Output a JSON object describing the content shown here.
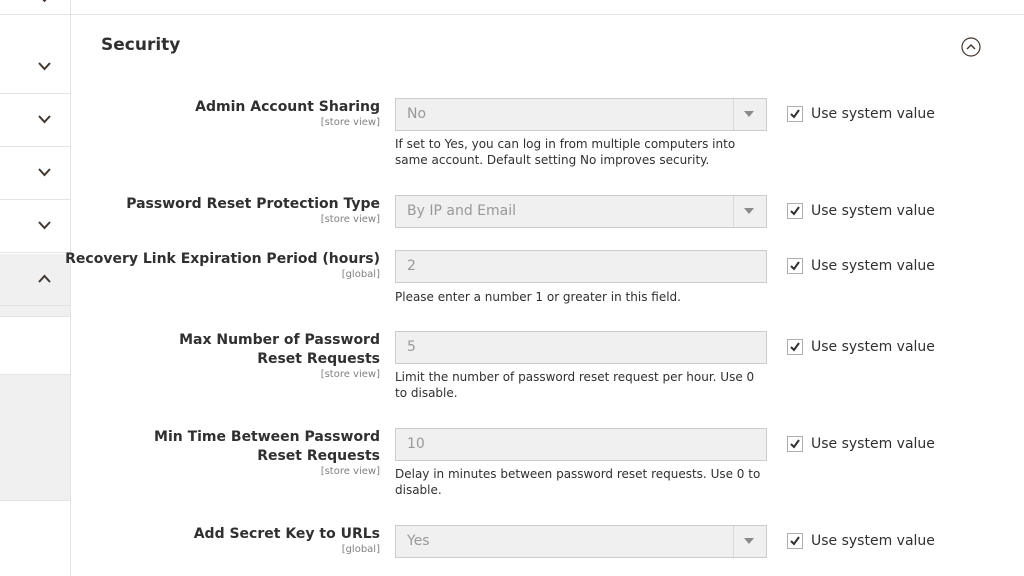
{
  "section": {
    "title": "Security"
  },
  "rows": [
    {
      "label": "Admin Account Sharing",
      "scope": "[store view]",
      "value": "No",
      "note": "If set to Yes, you can log in from multiple computers into same account. Default setting No improves security.",
      "use_system": "Use system value",
      "use_system_checked": true
    },
    {
      "label": "Password Reset Protection Type",
      "scope": "[store view]",
      "value": "By IP and Email",
      "note": "",
      "use_system": "Use system value",
      "use_system_checked": true
    },
    {
      "label": "Recovery Link Expiration Period (hours)",
      "scope": "[global]",
      "value": "2",
      "note": "Please enter a number 1 or greater in this field.",
      "use_system": "Use system value",
      "use_system_checked": true
    },
    {
      "label": "Max Number of Password Reset Requests",
      "scope": "[store view]",
      "value": "5",
      "note": "Limit the number of password reset request per hour. Use 0 to disable.",
      "use_system": "Use system value",
      "use_system_checked": true
    },
    {
      "label": "Min Time Between Password Reset Requests",
      "scope": "[store view]",
      "value": "10",
      "note": "Delay in minutes between password reset requests. Use 0 to disable.",
      "use_system": "Use system value",
      "use_system_checked": true
    },
    {
      "label": "Add Secret Key to URLs",
      "scope": "[global]",
      "value": "Yes",
      "note": "",
      "use_system": "Use system value",
      "use_system_checked": true
    }
  ],
  "icons": {
    "sidebar_chevron": "chevron-down-icon",
    "sidebar_open_chevron": "chevron-up-icon",
    "collapse": "circle-chevron-up-icon",
    "select_arrow": "triangle-down-icon",
    "check": "checkmark-icon"
  },
  "colors": {
    "disabled_field_bg": "#f0f0f0",
    "border": "#cccccc",
    "text": "#303030",
    "muted": "#808080"
  }
}
